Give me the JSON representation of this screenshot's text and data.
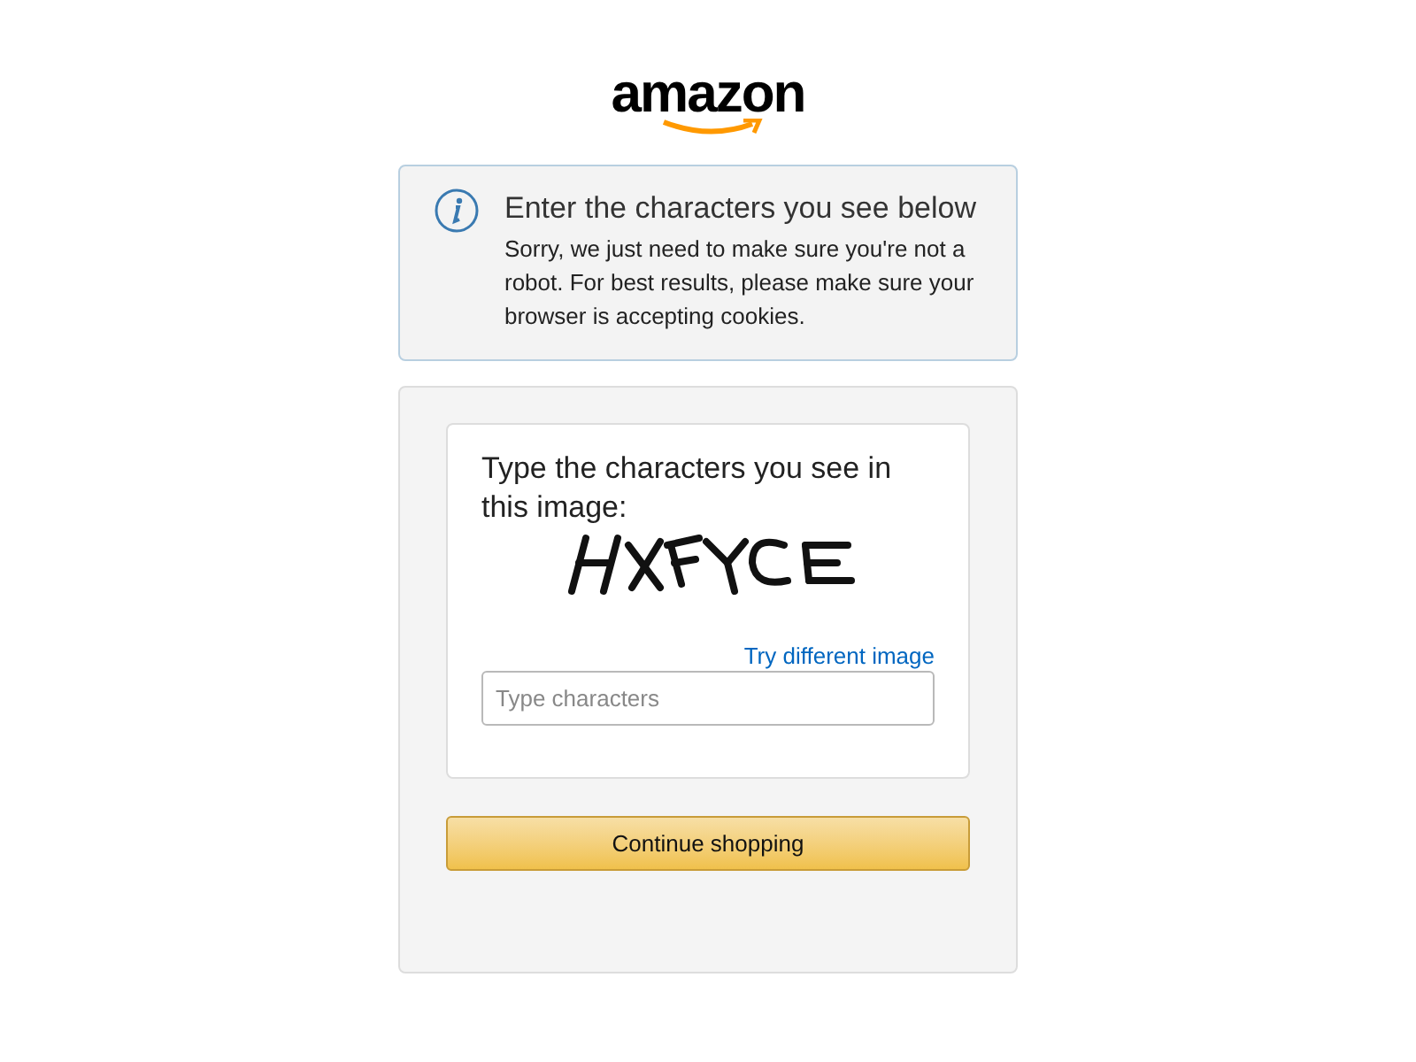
{
  "logo": {
    "text": "amazon"
  },
  "notice": {
    "title": "Enter the characters you see below",
    "message": "Sorry, we just need to make sure you're not a robot. For best results, please make sure your browser is accepting cookies."
  },
  "form": {
    "prompt": "Type the characters you see in this image:",
    "link": "Try different image",
    "field": {
      "placeholder": "Type characters"
    },
    "button": "Continue shopping"
  }
}
